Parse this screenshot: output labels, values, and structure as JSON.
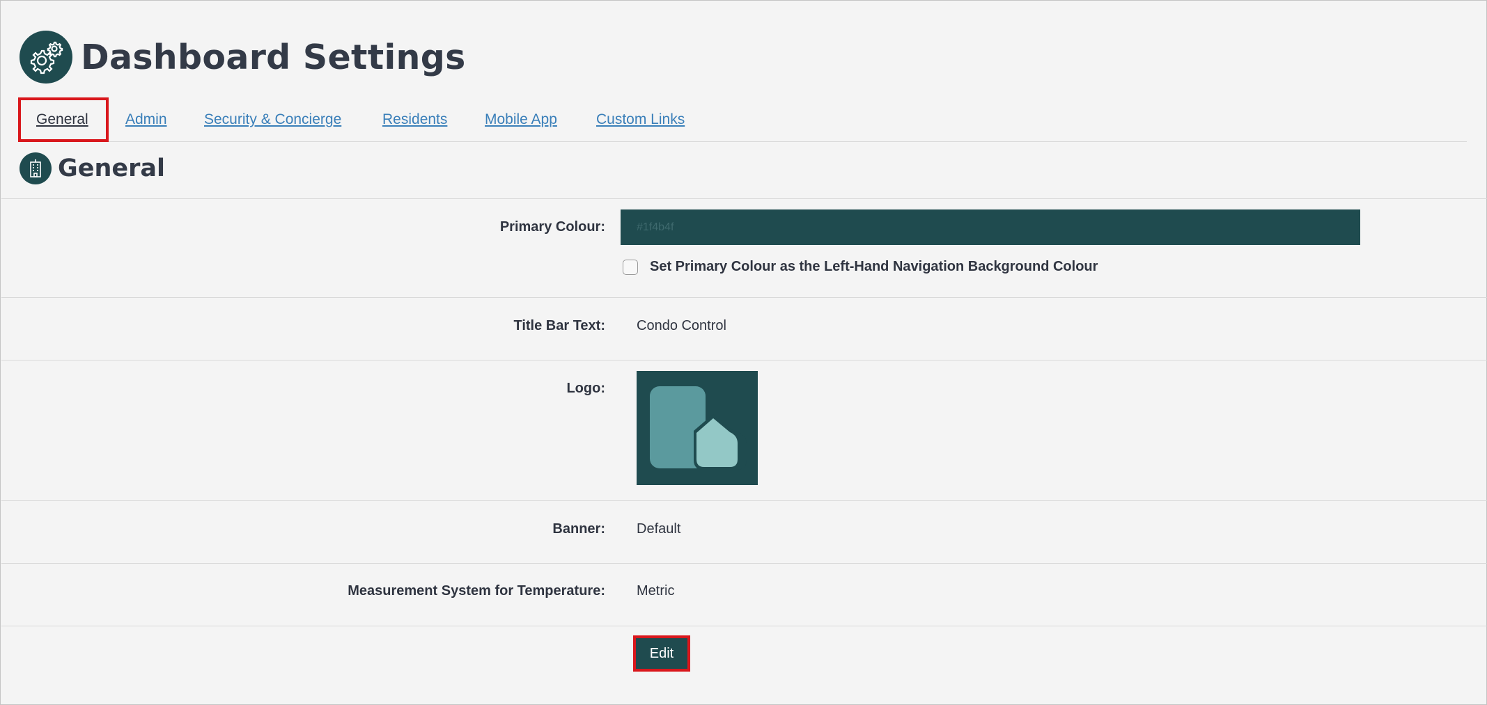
{
  "header": {
    "title": "Dashboard Settings",
    "icon": "gears-icon",
    "icon_bg": "#1f4b4f"
  },
  "tabs": [
    {
      "label": "General",
      "active": true
    },
    {
      "label": "Admin",
      "active": false
    },
    {
      "label": "Security & Concierge",
      "active": false
    },
    {
      "label": "Residents",
      "active": false
    },
    {
      "label": "Mobile App",
      "active": false
    },
    {
      "label": "Custom Links",
      "active": false
    }
  ],
  "section": {
    "title": "General",
    "icon": "building-icon"
  },
  "form": {
    "primary_colour": {
      "label": "Primary Colour:",
      "value": "#1f4b4f",
      "checkbox_label": "Set Primary Colour as the Left-Hand Navigation Background Colour",
      "checkbox_checked": false
    },
    "title_bar_text": {
      "label": "Title Bar Text:",
      "value": "Condo Control"
    },
    "logo": {
      "label": "Logo:",
      "icon": "condo-logo-icon",
      "bg": "#1f4b4f"
    },
    "banner": {
      "label": "Banner:",
      "value": "Default"
    },
    "measurement": {
      "label": "Measurement System for Temperature:",
      "value": "Metric"
    },
    "edit_label": "Edit"
  },
  "colors": {
    "accent": "#1f4b4f",
    "link": "#3a7fb9",
    "highlight": "#d9171c"
  }
}
